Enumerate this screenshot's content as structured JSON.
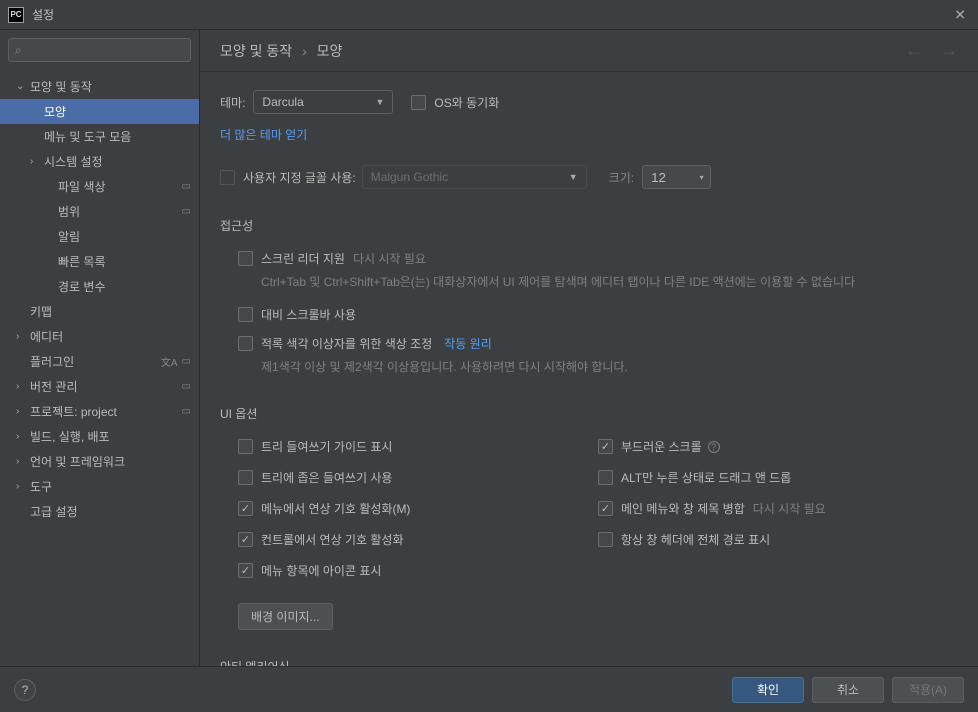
{
  "window": {
    "icon_text": "PC",
    "title": "설정"
  },
  "search": {
    "placeholder": ""
  },
  "sidebar": {
    "items": [
      {
        "label": "모양 및 동작",
        "chevron": "down",
        "indent": 0
      },
      {
        "label": "모양",
        "indent": 1,
        "selected": true
      },
      {
        "label": "메뉴 및 도구 모음",
        "indent": 1
      },
      {
        "label": "시스템 설정",
        "chevron": "right",
        "indent": 1
      },
      {
        "label": "파일 색상",
        "indent": 2,
        "badge": true
      },
      {
        "label": "범위",
        "indent": 2,
        "badge": true
      },
      {
        "label": "알림",
        "indent": 2
      },
      {
        "label": "빠른 목록",
        "indent": 2
      },
      {
        "label": "경로 변수",
        "indent": 2
      },
      {
        "label": "키맵",
        "indent": 0
      },
      {
        "label": "에디터",
        "chevron": "right",
        "indent": 0
      },
      {
        "label": "플러그인",
        "indent": 0,
        "lang": true,
        "badge": true
      },
      {
        "label": "버전 관리",
        "chevron": "right",
        "indent": 0,
        "badge": true
      },
      {
        "label": "프로젝트: project",
        "chevron": "right",
        "indent": 0,
        "badge": true
      },
      {
        "label": "빌드, 실행, 배포",
        "chevron": "right",
        "indent": 0
      },
      {
        "label": "언어 및 프레임워크",
        "chevron": "right",
        "indent": 0
      },
      {
        "label": "도구",
        "chevron": "right",
        "indent": 0
      },
      {
        "label": "고급 설정",
        "indent": 0
      }
    ]
  },
  "breadcrumb": {
    "parts": [
      "모양 및 동작",
      "모양"
    ]
  },
  "theme": {
    "label": "테마:",
    "value": "Darcula",
    "sync_label": "OS와 동기화"
  },
  "more_themes": "더 많은 테마 얻기",
  "custom_font": {
    "label": "사용자 지정 글꼴 사용:",
    "font_value": "Malgun Gothic",
    "size_label": "크기:",
    "size_value": "12"
  },
  "accessibility": {
    "title": "접근성",
    "screen_reader": {
      "label": "스크린 리더 지원",
      "hint": "다시 시작 필요",
      "desc": "Ctrl+Tab 및 Ctrl+Shift+Tab은(는) 대화상자에서 UI 제어를 탐색며 에디터 탭이나 다른 IDE 액션에는 이용할 수 없습니다"
    },
    "contrast_scrollbar": "대비 스크롤바 사용",
    "color_deficiency": {
      "label": "적록 색각 이상자를 위한 색상 조정",
      "link": "작동 원리",
      "desc": "제1색각 이상 및 제2색각 이상용입니다. 사용하려면 다시 시작해야 합니다."
    }
  },
  "ui_options": {
    "title": "UI 옵션",
    "left": [
      {
        "label": "트리 들여쓰기 가이드 표시",
        "checked": false
      },
      {
        "label": "트리에 좁은 들여쓰기 사용",
        "checked": false
      },
      {
        "label": "메뉴에서 연상 기호 활성화(M)",
        "checked": true
      },
      {
        "label": "컨트롤에서 연상 기호 활성화",
        "checked": true
      },
      {
        "label": "메뉴 항목에 아이콘 표시",
        "checked": true
      }
    ],
    "right": [
      {
        "label": "부드러운 스크롤",
        "checked": true,
        "help": true
      },
      {
        "label": "ALT만 누른 상태로 드래그 앤 드롭",
        "checked": false
      },
      {
        "label": "메인 메뉴와 창 제목 병합",
        "checked": true,
        "hint": "다시 시작 필요"
      },
      {
        "label": "항상 창 헤더에 전체 경로 표시",
        "checked": false
      }
    ],
    "bg_button": "배경 이미지..."
  },
  "antialiasing": {
    "title": "안티 엘리어싱"
  },
  "footer": {
    "ok": "확인",
    "cancel": "취소",
    "apply": "적용(A)"
  }
}
